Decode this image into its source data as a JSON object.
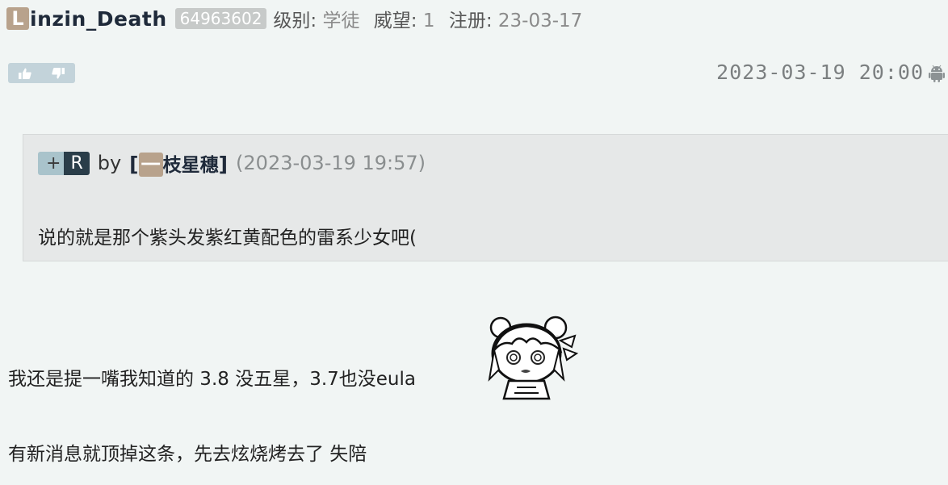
{
  "header": {
    "initial": "L",
    "name": "inzin_Death",
    "uid": "64963602",
    "level_label": "级别:",
    "level_value": "学徒",
    "prestige_label": "威望:",
    "prestige_value": "1",
    "register_label": "注册:",
    "register_value": "23-03-17"
  },
  "post": {
    "timestamp": "2023-03-19 20:00",
    "device_icon": "android-icon"
  },
  "quote": {
    "plus": "+",
    "reply_badge": "R",
    "by": "by",
    "bracket_open": "[",
    "author_initial": "一",
    "author_name": "枝星穗",
    "bracket_close": "]",
    "time": "(2023-03-19 19:57)",
    "text": "说的就是那个紫头发紫红黄配色的雷系少女吧("
  },
  "content": {
    "line1": "我还是提一嘴我知道的 3.8 没五星，3.7也没eula",
    "line2": "有新消息就顶掉这条，先去炫烧烤去了 失陪"
  },
  "colors": {
    "background": "#f1f5f4",
    "avatar_tag": "#b8a28c",
    "uid_badge": "#c7cac9",
    "quote_bg": "#e6e8e8",
    "reply_badge": "#2a3d49"
  }
}
